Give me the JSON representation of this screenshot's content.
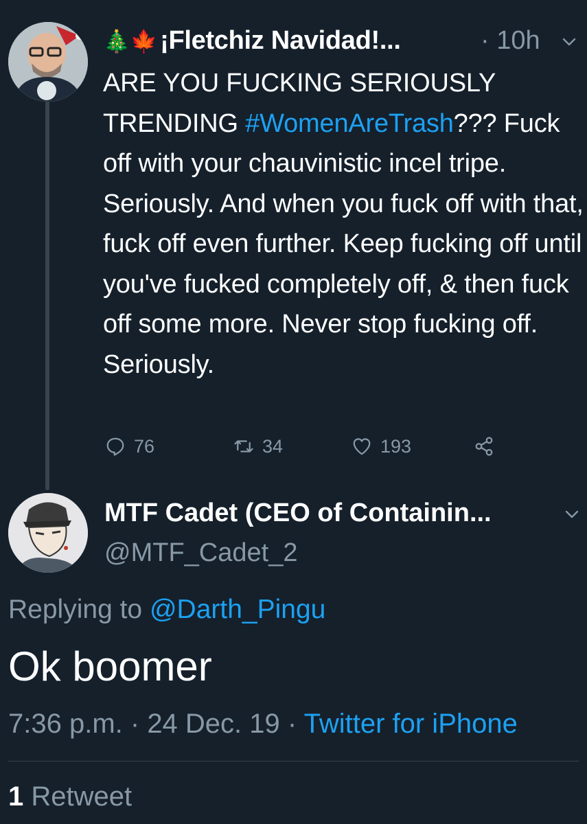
{
  "tweet_original": {
    "author_name": "¡Fletchiz Navidad!...",
    "author_flags": "🎄🍁",
    "time_ago": "· 10h",
    "text_before_hashtag": "ARE YOU FUCKING SERIOUSLY TRENDING ",
    "hashtag": "#WomenAreTrash",
    "text_after_hashtag": "??? Fuck off with your chauvinistic incel tripe. Seriously. And when you fuck off with that, fuck off even further. Keep fucking off until you've fucked completely off, & then fuck off some more. Never stop fucking off. Seriously.",
    "replies_count": "76",
    "retweets_count": "34",
    "likes_count": "193"
  },
  "tweet_reply": {
    "author_name": "MTF Cadet (CEO of Containin...",
    "handle": "@MTF_Cadet_2",
    "replying_prefix": "Replying to ",
    "replying_to": "@Darth_Pingu",
    "text": "Ok boomer",
    "time": "7:36 p.m.",
    "date": "24 Dec. 19",
    "source": "Twitter for iPhone",
    "retweet_count": "1",
    "retweet_label": "Retweet"
  },
  "icons": [
    "chevron-down-icon",
    "reply-icon",
    "retweet-icon",
    "like-icon",
    "share-icon"
  ],
  "colors": {
    "background": "#15202b",
    "text": "#ffffff",
    "secondary": "#8899a6",
    "accent": "#1da1f2",
    "divider": "#38444d"
  }
}
